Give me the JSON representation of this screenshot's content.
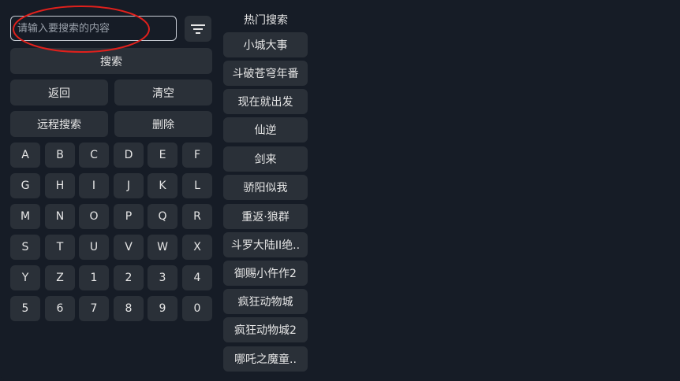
{
  "search": {
    "placeholder": "请输入要搜索的内容",
    "value": ""
  },
  "icons": {
    "filter": "filter-icon"
  },
  "actions": {
    "search": "搜索",
    "back": "返回",
    "clear": "清空",
    "remote_search": "远程搜索",
    "delete": "删除"
  },
  "keys": [
    "A",
    "B",
    "C",
    "D",
    "E",
    "F",
    "G",
    "H",
    "I",
    "J",
    "K",
    "L",
    "M",
    "N",
    "O",
    "P",
    "Q",
    "R",
    "S",
    "T",
    "U",
    "V",
    "W",
    "X",
    "Y",
    "Z",
    "1",
    "2",
    "3",
    "4",
    "5",
    "6",
    "7",
    "8",
    "9",
    "0"
  ],
  "hot": {
    "title": "热门搜索",
    "items": [
      "小城大事",
      "斗破苍穹年番",
      "现在就出发",
      "仙逆",
      "剑来",
      "骄阳似我",
      "重返·狼群",
      "斗罗大陆II绝..",
      "御赐小仵作2",
      "疯狂动物城",
      "疯狂动物城2",
      "哪吒之魔童.."
    ]
  },
  "colors": {
    "background": "#161c26",
    "button": "#2a3038",
    "annotation": "#e0201c"
  }
}
